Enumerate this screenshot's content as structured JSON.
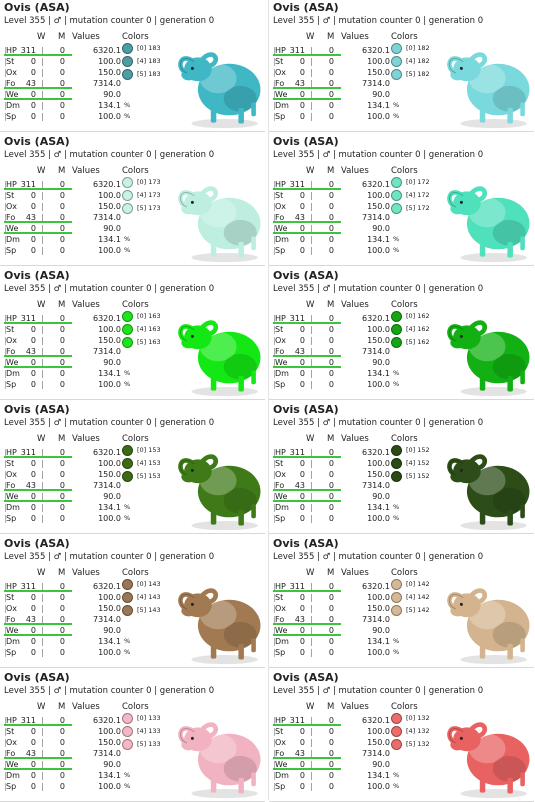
{
  "cards": [
    {
      "title": "Ovis (ASA)",
      "subtitle": "Level 355 | ♂ | mutation counter 0 | generation 0",
      "headers": {
        "w": "W",
        "m": "M",
        "values": "Values",
        "colors": "Colors"
      },
      "stats": [
        [
          "HP",
          "311",
          "0",
          "6320.1"
        ],
        [
          "St",
          "0",
          "0",
          "100.0"
        ],
        [
          "Ox",
          "0",
          "0",
          "150.0"
        ],
        [
          "Fo",
          "43",
          "0",
          "7314.0"
        ],
        [
          "We",
          "0",
          "0",
          "90.0"
        ],
        [
          "Dm",
          "0",
          "0",
          "134.1"
        ],
        [
          "Sp",
          "0",
          "0",
          "100.0"
        ]
      ],
      "colors": [
        {
          "label": "[0] 183",
          "color": "#4d9ea4"
        },
        {
          "label": "[4] 183",
          "color": "#4d9ea4"
        },
        {
          "label": "[5] 183",
          "color": "#4d9ea4"
        }
      ],
      "sheep_color": "#3fb7c4",
      "percent": "%"
    },
    {
      "title": "Ovis (ASA)",
      "subtitle": "Level 355 | ♂ | mutation counter 0 | generation 0",
      "headers": {
        "w": "W",
        "m": "M",
        "values": "Values",
        "colors": "Colors"
      },
      "stats": [
        [
          "HP",
          "311",
          "0",
          "6320.1"
        ],
        [
          "St",
          "0",
          "0",
          "100.0"
        ],
        [
          "Ox",
          "0",
          "0",
          "150.0"
        ],
        [
          "Fo",
          "43",
          "0",
          "7314.0"
        ],
        [
          "We",
          "0",
          "0",
          "90.0"
        ],
        [
          "Dm",
          "0",
          "0",
          "134.1"
        ],
        [
          "Sp",
          "0",
          "0",
          "100.0"
        ]
      ],
      "colors": [
        {
          "label": "[0] 182",
          "color": "#7fd3d6"
        },
        {
          "label": "[4] 182",
          "color": "#7fd3d6"
        },
        {
          "label": "[5] 182",
          "color": "#7fd3d6"
        }
      ],
      "sheep_color": "#7ad9dc",
      "percent": "%"
    },
    {
      "title": "Ovis (ASA)",
      "subtitle": "Level 355 | ♂ | mutation counter 0 | generation 0",
      "headers": {
        "w": "W",
        "m": "M",
        "values": "Values",
        "colors": "Colors"
      },
      "stats": [
        [
          "HP",
          "311",
          "0",
          "6320.1"
        ],
        [
          "St",
          "0",
          "0",
          "100.0"
        ],
        [
          "Ox",
          "0",
          "0",
          "150.0"
        ],
        [
          "Fo",
          "43",
          "0",
          "7314.0"
        ],
        [
          "We",
          "0",
          "0",
          "90.0"
        ],
        [
          "Dm",
          "0",
          "0",
          "134.1"
        ],
        [
          "Sp",
          "0",
          "0",
          "100.0"
        ]
      ],
      "colors": [
        {
          "label": "[0] 173",
          "color": "#c8f2e4"
        },
        {
          "label": "[4] 173",
          "color": "#c8f2e4"
        },
        {
          "label": "[5] 173",
          "color": "#c8f2e4"
        }
      ],
      "sheep_color": "#bdeee0",
      "percent": "%"
    },
    {
      "title": "Ovis (ASA)",
      "subtitle": "Level 355 | ♂ | mutation counter 0 | generation 0",
      "headers": {
        "w": "W",
        "m": "M",
        "values": "Values",
        "colors": "Colors"
      },
      "stats": [
        [
          "HP",
          "311",
          "0",
          "6320.1"
        ],
        [
          "St",
          "0",
          "0",
          "100.0"
        ],
        [
          "Ox",
          "0",
          "0",
          "150.0"
        ],
        [
          "Fo",
          "43",
          "0",
          "7314.0"
        ],
        [
          "We",
          "0",
          "0",
          "90.0"
        ],
        [
          "Dm",
          "0",
          "0",
          "134.1"
        ],
        [
          "Sp",
          "0",
          "0",
          "100.0"
        ]
      ],
      "colors": [
        {
          "label": "[0] 172",
          "color": "#6fe6c2"
        },
        {
          "label": "[4] 172",
          "color": "#6fe6c2"
        },
        {
          "label": "[5] 172",
          "color": "#6fe6c2"
        }
      ],
      "sheep_color": "#4fe0bc",
      "percent": "%"
    },
    {
      "title": "Ovis (ASA)",
      "subtitle": "Level 355 | ♂ | mutation counter 0 | generation 0",
      "headers": {
        "w": "W",
        "m": "M",
        "values": "Values",
        "colors": "Colors"
      },
      "stats": [
        [
          "HP",
          "311",
          "0",
          "6320.1"
        ],
        [
          "St",
          "0",
          "0",
          "100.0"
        ],
        [
          "Ox",
          "0",
          "0",
          "150.0"
        ],
        [
          "Fo",
          "43",
          "0",
          "7314.0"
        ],
        [
          "We",
          "0",
          "0",
          "90.0"
        ],
        [
          "Dm",
          "0",
          "0",
          "134.1"
        ],
        [
          "Sp",
          "0",
          "0",
          "100.0"
        ]
      ],
      "colors": [
        {
          "label": "[0] 163",
          "color": "#1de41d"
        },
        {
          "label": "[4] 163",
          "color": "#1de41d"
        },
        {
          "label": "[5] 163",
          "color": "#1de41d"
        }
      ],
      "sheep_color": "#14e814",
      "percent": "%"
    },
    {
      "title": "Ovis (ASA)",
      "subtitle": "Level 355 | ♂ | mutation counter 0 | generation 0",
      "headers": {
        "w": "W",
        "m": "M",
        "values": "Values",
        "colors": "Colors"
      },
      "stats": [
        [
          "HP",
          "311",
          "0",
          "6320.1"
        ],
        [
          "St",
          "0",
          "0",
          "100.0"
        ],
        [
          "Ox",
          "0",
          "0",
          "150.0"
        ],
        [
          "Fo",
          "43",
          "0",
          "7314.0"
        ],
        [
          "We",
          "0",
          "0",
          "90.0"
        ],
        [
          "Dm",
          "0",
          "0",
          "134.1"
        ],
        [
          "Sp",
          "0",
          "0",
          "100.0"
        ]
      ],
      "colors": [
        {
          "label": "[0] 162",
          "color": "#14a614"
        },
        {
          "label": "[4] 162",
          "color": "#14a614"
        },
        {
          "label": "[5] 162",
          "color": "#14a614"
        }
      ],
      "sheep_color": "#12b012",
      "percent": "%"
    },
    {
      "title": "Ovis (ASA)",
      "subtitle": "Level 355 | ♂ | mutation counter 0 | generation 0",
      "headers": {
        "w": "W",
        "m": "M",
        "values": "Values",
        "colors": "Colors"
      },
      "stats": [
        [
          "HP",
          "311",
          "0",
          "6320.1"
        ],
        [
          "St",
          "0",
          "0",
          "100.0"
        ],
        [
          "Ox",
          "0",
          "0",
          "150.0"
        ],
        [
          "Fo",
          "43",
          "0",
          "7314.0"
        ],
        [
          "We",
          "0",
          "0",
          "90.0"
        ],
        [
          "Dm",
          "0",
          "0",
          "134.1"
        ],
        [
          "Sp",
          "0",
          "0",
          "100.0"
        ]
      ],
      "colors": [
        {
          "label": "[0] 153",
          "color": "#3b6b14"
        },
        {
          "label": "[4] 153",
          "color": "#3b6b14"
        },
        {
          "label": "[5] 153",
          "color": "#3b6b14"
        }
      ],
      "sheep_color": "#3f7a18",
      "percent": "%"
    },
    {
      "title": "Ovis (ASA)",
      "subtitle": "Level 355 | ♂ | mutation counter 0 | generation 0",
      "headers": {
        "w": "W",
        "m": "M",
        "values": "Values",
        "colors": "Colors"
      },
      "stats": [
        [
          "HP",
          "311",
          "0",
          "6320.1"
        ],
        [
          "St",
          "0",
          "0",
          "100.0"
        ],
        [
          "Ox",
          "0",
          "0",
          "150.0"
        ],
        [
          "Fo",
          "43",
          "0",
          "7314.0"
        ],
        [
          "We",
          "0",
          "0",
          "90.0"
        ],
        [
          "Dm",
          "0",
          "0",
          "134.1"
        ],
        [
          "Sp",
          "0",
          "0",
          "100.0"
        ]
      ],
      "colors": [
        {
          "label": "[0] 152",
          "color": "#2a4a16"
        },
        {
          "label": "[4] 152",
          "color": "#2a4a16"
        },
        {
          "label": "[5] 152",
          "color": "#2a4a16"
        }
      ],
      "sheep_color": "#2c4d18",
      "percent": "%"
    },
    {
      "title": "Ovis (ASA)",
      "subtitle": "Level 355 | ♂ | mutation counter 0 | generation 0",
      "headers": {
        "w": "W",
        "m": "M",
        "values": "Values",
        "colors": "Colors"
      },
      "stats": [
        [
          "HP",
          "311",
          "0",
          "6320.1"
        ],
        [
          "St",
          "0",
          "0",
          "100.0"
        ],
        [
          "Ox",
          "0",
          "0",
          "150.0"
        ],
        [
          "Fo",
          "43",
          "0",
          "7314.0"
        ],
        [
          "We",
          "0",
          "0",
          "90.0"
        ],
        [
          "Dm",
          "0",
          "0",
          "134.1"
        ],
        [
          "Sp",
          "0",
          "0",
          "100.0"
        ]
      ],
      "colors": [
        {
          "label": "[0] 143",
          "color": "#9a7656"
        },
        {
          "label": "[4] 143",
          "color": "#9a7656"
        },
        {
          "label": "[5] 143",
          "color": "#9a7656"
        }
      ],
      "sheep_color": "#a17a52",
      "percent": "%"
    },
    {
      "title": "Ovis (ASA)",
      "subtitle": "Level 355 | ♂ | mutation counter 0 | generation 0",
      "headers": {
        "w": "W",
        "m": "M",
        "values": "Values",
        "colors": "Colors"
      },
      "stats": [
        [
          "HP",
          "311",
          "0",
          "6320.1"
        ],
        [
          "St",
          "0",
          "0",
          "100.0"
        ],
        [
          "Ox",
          "0",
          "0",
          "150.0"
        ],
        [
          "Fo",
          "43",
          "0",
          "7314.0"
        ],
        [
          "We",
          "0",
          "0",
          "90.0"
        ],
        [
          "Dm",
          "0",
          "0",
          "134.1"
        ],
        [
          "Sp",
          "0",
          "0",
          "100.0"
        ]
      ],
      "colors": [
        {
          "label": "[0] 142",
          "color": "#d6b894"
        },
        {
          "label": "[4] 142",
          "color": "#d6b894"
        },
        {
          "label": "[5] 142",
          "color": "#d6b894"
        }
      ],
      "sheep_color": "#d3b48e",
      "percent": "%"
    },
    {
      "title": "Ovis (ASA)",
      "subtitle": "Level 355 | ♂ | mutation counter 0 | generation 0",
      "headers": {
        "w": "W",
        "m": "M",
        "values": "Values",
        "colors": "Colors"
      },
      "stats": [
        [
          "HP",
          "311",
          "0",
          "6320.1"
        ],
        [
          "St",
          "0",
          "0",
          "100.0"
        ],
        [
          "Ox",
          "0",
          "0",
          "150.0"
        ],
        [
          "Fo",
          "43",
          "0",
          "7314.0"
        ],
        [
          "We",
          "0",
          "0",
          "90.0"
        ],
        [
          "Dm",
          "0",
          "0",
          "134.1"
        ],
        [
          "Sp",
          "0",
          "0",
          "100.0"
        ]
      ],
      "colors": [
        {
          "label": "[0] 133",
          "color": "#f4b8c4"
        },
        {
          "label": "[4] 133",
          "color": "#f4b8c4"
        },
        {
          "label": "[5] 133",
          "color": "#f4b8c4"
        }
      ],
      "sheep_color": "#f1b3c1",
      "percent": "%"
    },
    {
      "title": "Ovis (ASA)",
      "subtitle": "Level 355 | ♂ | mutation counter 0 | generation 0",
      "headers": {
        "w": "W",
        "m": "M",
        "values": "Values",
        "colors": "Colors"
      },
      "stats": [
        [
          "HP",
          "311",
          "0",
          "6320.1"
        ],
        [
          "St",
          "0",
          "0",
          "100.0"
        ],
        [
          "Ox",
          "0",
          "0",
          "150.0"
        ],
        [
          "Fo",
          "43",
          "0",
          "7314.0"
        ],
        [
          "We",
          "0",
          "0",
          "90.0"
        ],
        [
          "Dm",
          "0",
          "0",
          "134.1"
        ],
        [
          "Sp",
          "0",
          "0",
          "100.0"
        ]
      ],
      "colors": [
        {
          "label": "[0] 132",
          "color": "#ec6c6c"
        },
        {
          "label": "[4] 132",
          "color": "#ec6c6c"
        },
        {
          "label": "[5] 132",
          "color": "#ec6c6c"
        }
      ],
      "sheep_color": "#e86262",
      "percent": "%"
    }
  ]
}
